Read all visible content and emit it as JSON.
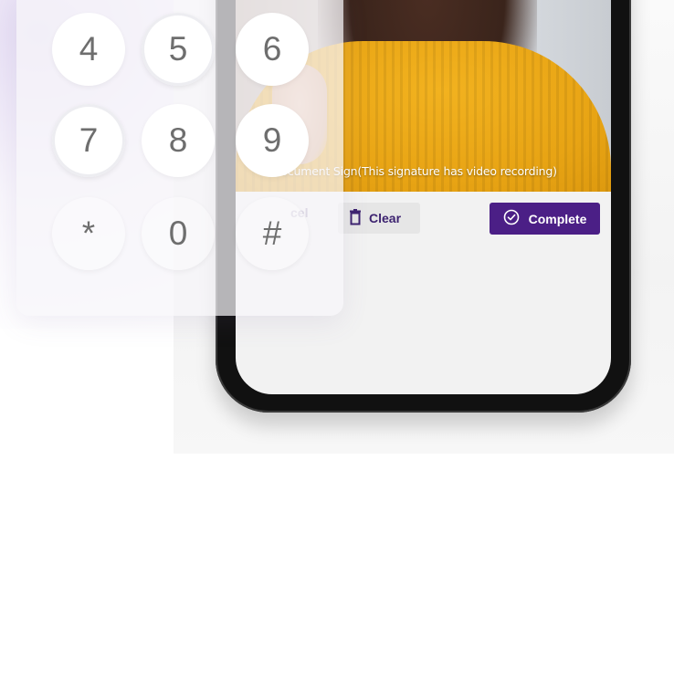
{
  "keypad": {
    "keys": [
      {
        "label": "4"
      },
      {
        "label": "5"
      },
      {
        "label": "6"
      },
      {
        "label": "7"
      },
      {
        "label": "8"
      },
      {
        "label": "9"
      },
      {
        "label": "*"
      },
      {
        "label": "0"
      },
      {
        "label": "#"
      }
    ]
  },
  "signing_screen": {
    "caption": "Document Sign(This signature has video recording)",
    "cancel_label": "cel",
    "clear_label": "Clear",
    "complete_label": "Complete",
    "icons": {
      "clear": "trash-icon",
      "complete": "check-circle-icon"
    }
  },
  "colors": {
    "accent": "#4b1f86",
    "sweater": "#e8a414",
    "key_text": "#6e6e6e"
  }
}
